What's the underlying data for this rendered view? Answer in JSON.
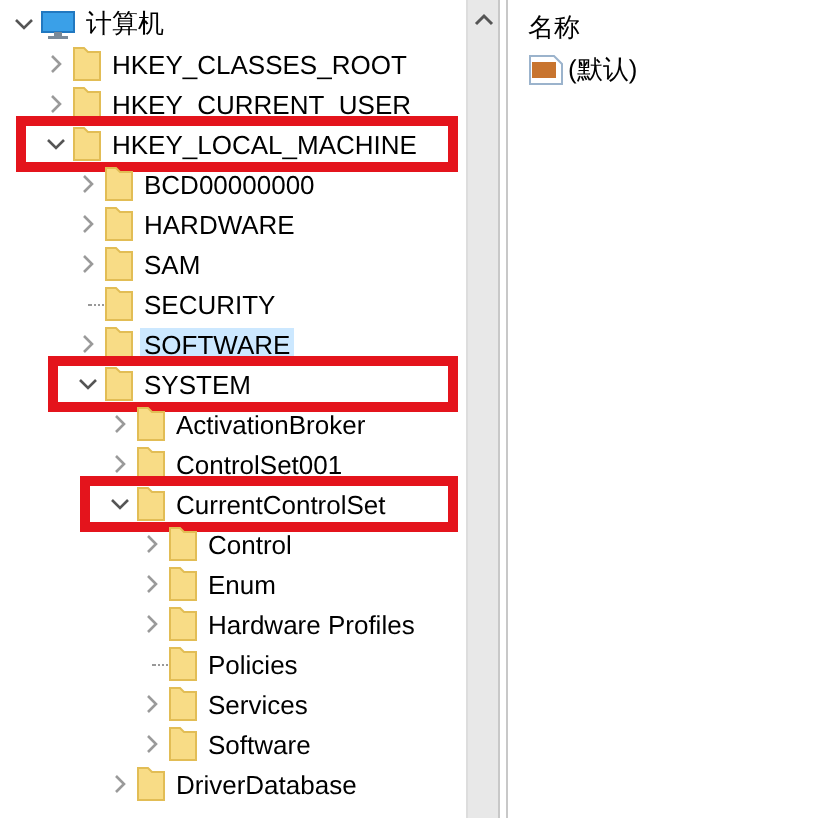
{
  "tree": {
    "root": {
      "label": "计算机",
      "expanded": true,
      "children": [
        {
          "label": "HKEY_CLASSES_ROOT",
          "expandable": true,
          "expanded": false,
          "selected": false,
          "highlighted": false
        },
        {
          "label": "HKEY_CURRENT_USER",
          "expandable": true,
          "expanded": false,
          "selected": false,
          "highlighted": false
        },
        {
          "label": "HKEY_LOCAL_MACHINE",
          "expandable": true,
          "expanded": true,
          "selected": false,
          "highlighted": true,
          "children": [
            {
              "label": "BCD00000000",
              "expandable": true,
              "expanded": false,
              "selected": false,
              "highlighted": false
            },
            {
              "label": "HARDWARE",
              "expandable": true,
              "expanded": false,
              "selected": false,
              "highlighted": false
            },
            {
              "label": "SAM",
              "expandable": true,
              "expanded": false,
              "selected": false,
              "highlighted": false
            },
            {
              "label": "SECURITY",
              "expandable": false,
              "selected": false,
              "highlighted": false
            },
            {
              "label": "SOFTWARE",
              "expandable": true,
              "expanded": false,
              "selected": true,
              "highlighted": false
            },
            {
              "label": "SYSTEM",
              "expandable": true,
              "expanded": true,
              "selected": false,
              "highlighted": true,
              "children": [
                {
                  "label": "ActivationBroker",
                  "expandable": true,
                  "expanded": false,
                  "selected": false,
                  "highlighted": false
                },
                {
                  "label": "ControlSet001",
                  "expandable": true,
                  "expanded": false,
                  "selected": false,
                  "highlighted": false
                },
                {
                  "label": "CurrentControlSet",
                  "expandable": true,
                  "expanded": true,
                  "selected": false,
                  "highlighted": true,
                  "children": [
                    {
                      "label": "Control",
                      "expandable": true,
                      "expanded": false,
                      "selected": false,
                      "highlighted": false
                    },
                    {
                      "label": "Enum",
                      "expandable": true,
                      "expanded": false,
                      "selected": false,
                      "highlighted": false
                    },
                    {
                      "label": "Hardware Profiles",
                      "expandable": true,
                      "expanded": false,
                      "selected": false,
                      "highlighted": false
                    },
                    {
                      "label": "Policies",
                      "expandable": false,
                      "selected": false,
                      "highlighted": false
                    },
                    {
                      "label": "Services",
                      "expandable": true,
                      "expanded": false,
                      "selected": false,
                      "highlighted": false
                    },
                    {
                      "label": "Software",
                      "expandable": true,
                      "expanded": false,
                      "selected": false,
                      "highlighted": false
                    }
                  ]
                },
                {
                  "label": "DriverDatabase",
                  "expandable": true,
                  "expanded": false,
                  "selected": false,
                  "highlighted": false
                }
              ]
            }
          ]
        }
      ]
    }
  },
  "values": {
    "columns": [
      "名称"
    ],
    "rows": [
      {
        "name": "(默认)"
      }
    ]
  }
}
